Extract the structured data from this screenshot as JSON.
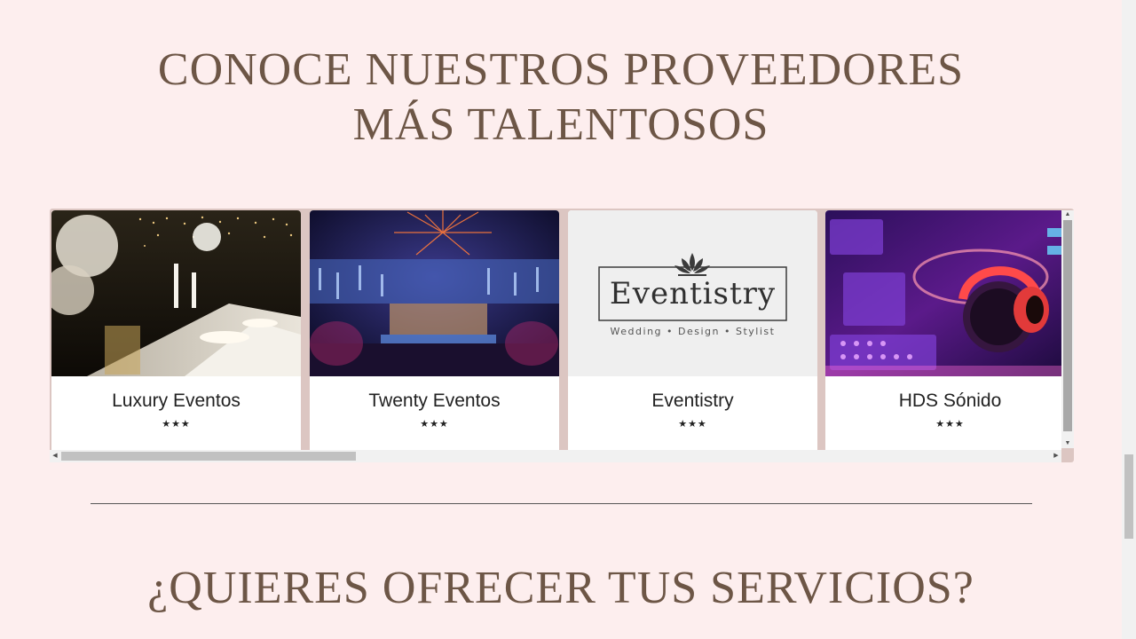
{
  "sections": {
    "providers_title": "CONOCE NUESTROS PROVEEDORES MÁS TALENTOSOS",
    "offer_title": "¿QUIERES OFRECER TUS SERVICIOS?"
  },
  "providers": [
    {
      "name": "Luxury Eventos",
      "rating": "★★★"
    },
    {
      "name": "Twenty Eventos",
      "rating": "★★★"
    },
    {
      "name": "Eventistry",
      "rating": "★★★"
    },
    {
      "name": "HDS Sónido",
      "rating": "★★★"
    }
  ],
  "eventistry_logo": {
    "wordmark": "Eventistry",
    "tagline": "Wedding • Design • Stylist"
  },
  "colors": {
    "background": "#fdeeee",
    "heading": "#6d5646",
    "carousel_frame": "#dcc6c2"
  }
}
